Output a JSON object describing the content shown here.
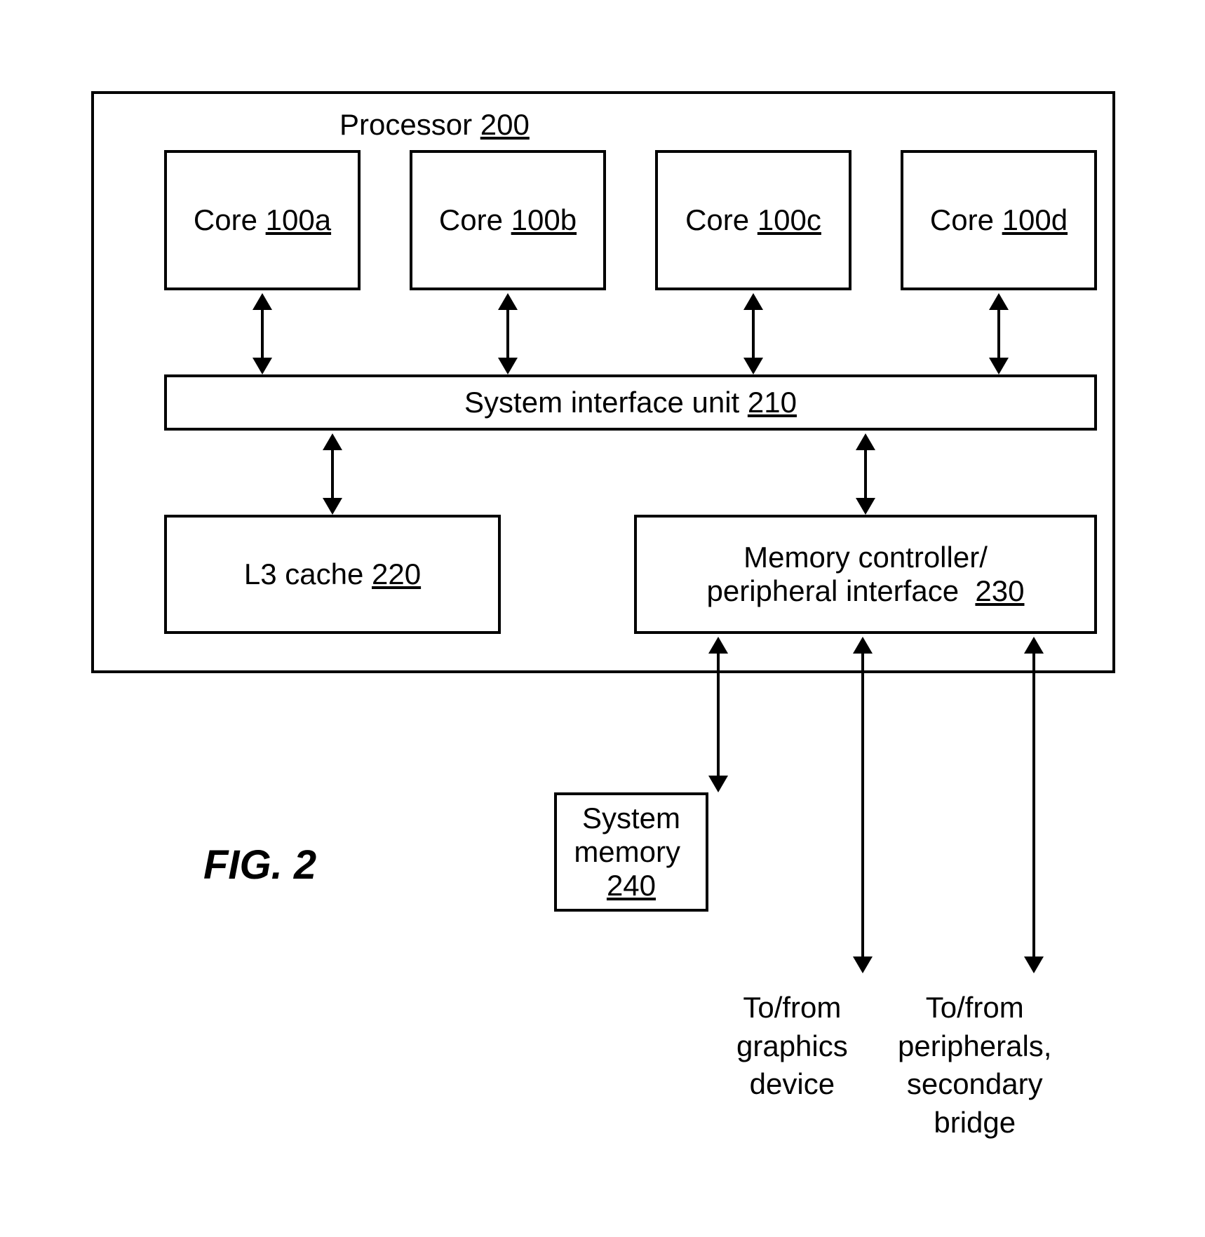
{
  "processor": {
    "title_text": "Processor",
    "title_ref": "200"
  },
  "cores": {
    "a": {
      "label": "Core",
      "ref": "100a"
    },
    "b": {
      "label": "Core",
      "ref": "100b"
    },
    "c": {
      "label": "Core",
      "ref": "100c"
    },
    "d": {
      "label": "Core",
      "ref": "100d"
    }
  },
  "siu": {
    "label": "System interface unit",
    "ref": "210"
  },
  "l3": {
    "label": "L3 cache",
    "ref": "220"
  },
  "memctl": {
    "line1": "Memory controller/",
    "line2": "peripheral interface",
    "ref": "230"
  },
  "sysmem": {
    "line1": "System",
    "line2": "memory",
    "ref": "240"
  },
  "fig": "FIG. 2",
  "graphics_label": "To/from\ngraphics\ndevice",
  "peripherals_label": "To/from\nperipherals,\nsecondary\nbridge"
}
